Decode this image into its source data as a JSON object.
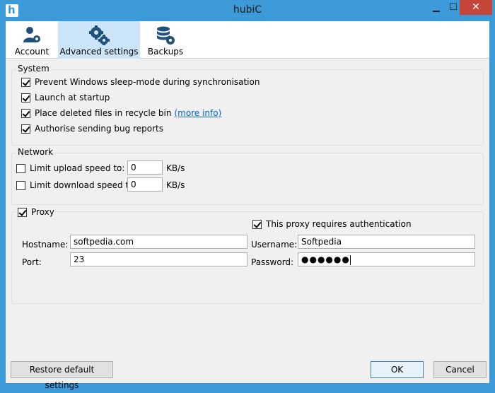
{
  "window": {
    "title": "hubiC"
  },
  "tabs": [
    {
      "label": "Account",
      "icon": "user-gear-icon"
    },
    {
      "label": "Advanced settings",
      "icon": "gears-icon"
    },
    {
      "label": "Backups",
      "icon": "database-gear-icon"
    }
  ],
  "system": {
    "legend": "System",
    "options": [
      {
        "label": "Prevent Windows sleep-mode during synchronisation",
        "checked": true
      },
      {
        "label": "Launch at startup",
        "checked": true
      },
      {
        "label": "Place deleted files in recycle bin",
        "checked": true,
        "link": "(more info)"
      },
      {
        "label": "Authorise sending bug reports",
        "checked": true
      }
    ]
  },
  "network": {
    "legend": "Network",
    "upload_label": "Limit upload speed to:",
    "upload_value": "0",
    "download_label": "Limit download speed to:",
    "download_value": "0",
    "unit": "KB/s"
  },
  "proxy": {
    "legend": "Proxy",
    "auth_label": "This proxy requires authentication",
    "hostname_label": "Hostname:",
    "hostname_value": "softpedia.com",
    "port_label": "Port:",
    "port_value": "23",
    "username_label": "Username:",
    "username_value": "Softpedia",
    "password_label": "Password:",
    "password_value": "●●●●●●"
  },
  "footer": {
    "restore_label": "Restore default settings",
    "ok_label": "OK",
    "cancel_label": "Cancel"
  },
  "colors": {
    "frame": "#3d9ad8",
    "close": "#c7463c",
    "active_tab": "#cce4f7",
    "link": "#0066cc"
  }
}
